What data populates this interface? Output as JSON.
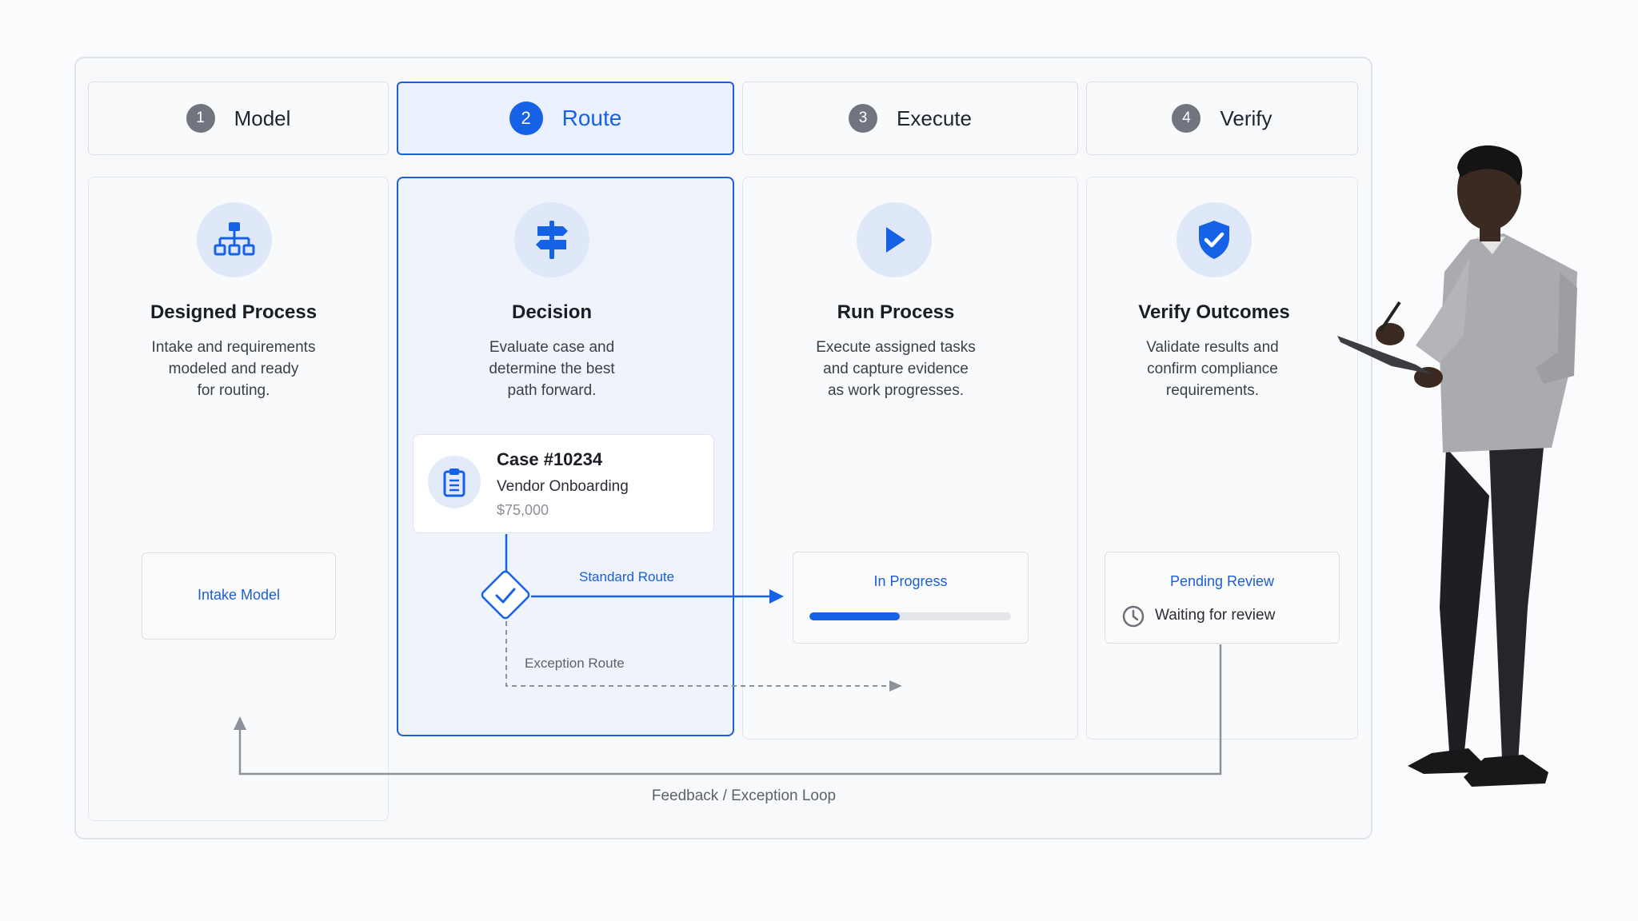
{
  "steps": [
    {
      "number": "1",
      "label": "Model"
    },
    {
      "number": "2",
      "label": "Route"
    },
    {
      "number": "3",
      "label": "Execute"
    },
    {
      "number": "4",
      "label": "Verify"
    }
  ],
  "columns": [
    {
      "icon": "hierarchy-icon",
      "title": "Designed Process",
      "desc": [
        "Intake and requirements",
        "modeled and ready",
        "for routing."
      ]
    },
    {
      "icon": "signpost-icon",
      "title": "Decision",
      "desc": [
        "Evaluate case and",
        "determine the best",
        "path forward."
      ]
    },
    {
      "icon": "play-icon",
      "title": "Run Process",
      "desc": [
        "Execute assigned tasks",
        "and capture evidence",
        "as work progresses."
      ]
    },
    {
      "icon": "shield-check-icon",
      "title": "Verify Outcomes",
      "desc": [
        "Validate results and",
        "confirm compliance",
        "requirements."
      ]
    }
  ],
  "intake_model": "Intake Model",
  "case": {
    "id": "Case #10234",
    "name": "Vendor Onboarding",
    "amount": "$75,000",
    "icon": "clipboard-icon"
  },
  "routes": {
    "standard": "Standard Route",
    "exception": "Exception Route"
  },
  "execute_status": {
    "label": "In Progress",
    "progress": 0.45
  },
  "verify_status": {
    "label": "Pending Review",
    "detail": "Waiting for review",
    "icon": "clock-icon"
  },
  "loop_label": "Feedback / Exception Loop",
  "colors": {
    "accent": "#1662e6",
    "muted": "#707580",
    "icon_bg": "#dfe8f8"
  }
}
